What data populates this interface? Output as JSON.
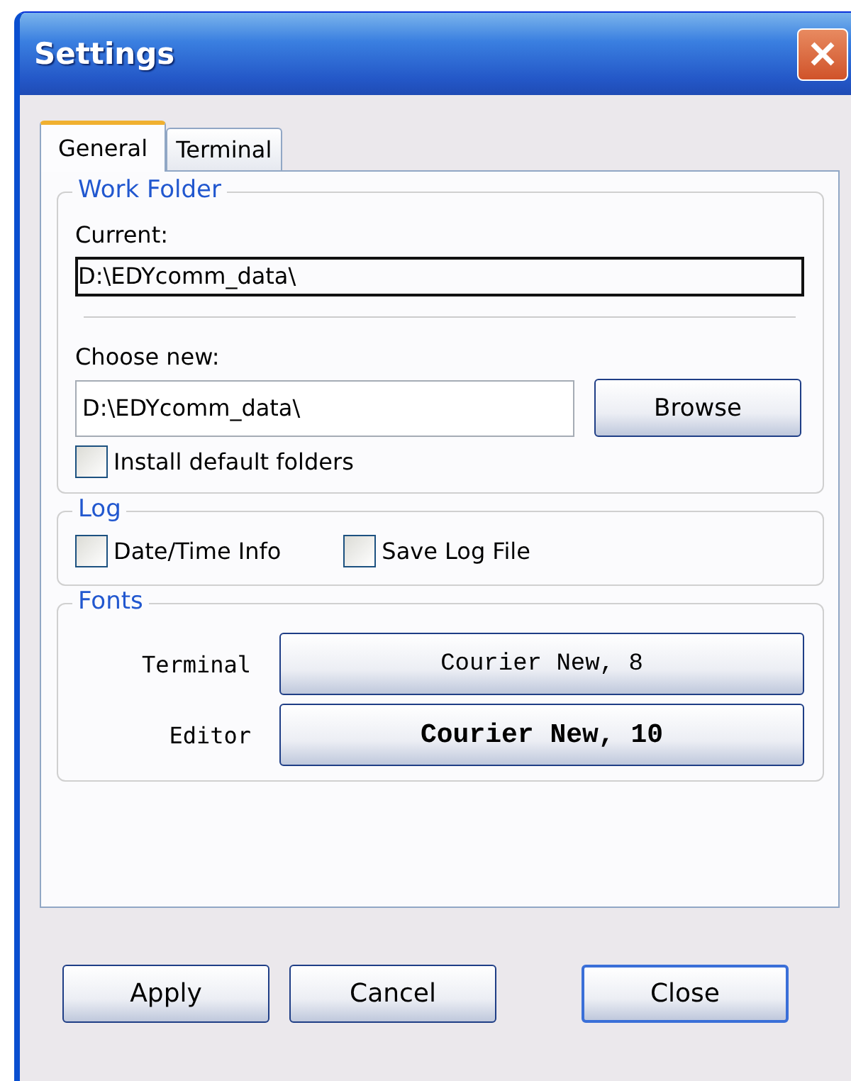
{
  "window": {
    "title": "Settings"
  },
  "tabs": [
    {
      "label": "General",
      "selected": true
    },
    {
      "label": "Terminal",
      "selected": false
    }
  ],
  "work_folder": {
    "title": "Work Folder",
    "current_label": "Current:",
    "current_value": "D:\\EDYcomm_data\\",
    "choose_label": "Choose new:",
    "choose_value": "D:\\EDYcomm_data\\",
    "browse_button": "Browse",
    "install_checkbox": {
      "label": "Install default folders",
      "checked": false
    }
  },
  "log": {
    "title": "Log",
    "checkboxes": [
      {
        "label": "Date/Time Info",
        "checked": false
      },
      {
        "label": "Save Log File",
        "checked": false
      }
    ]
  },
  "fonts": {
    "title": "Fonts",
    "rows": [
      {
        "label": "Terminal",
        "button": "Courier New, 8",
        "bold": false
      },
      {
        "label": "Editor",
        "button": "Courier New, 10",
        "bold": true
      }
    ]
  },
  "buttons": [
    {
      "label": "Apply",
      "default": false
    },
    {
      "label": "Cancel",
      "default": false
    },
    {
      "label": "Close",
      "default": true
    }
  ]
}
